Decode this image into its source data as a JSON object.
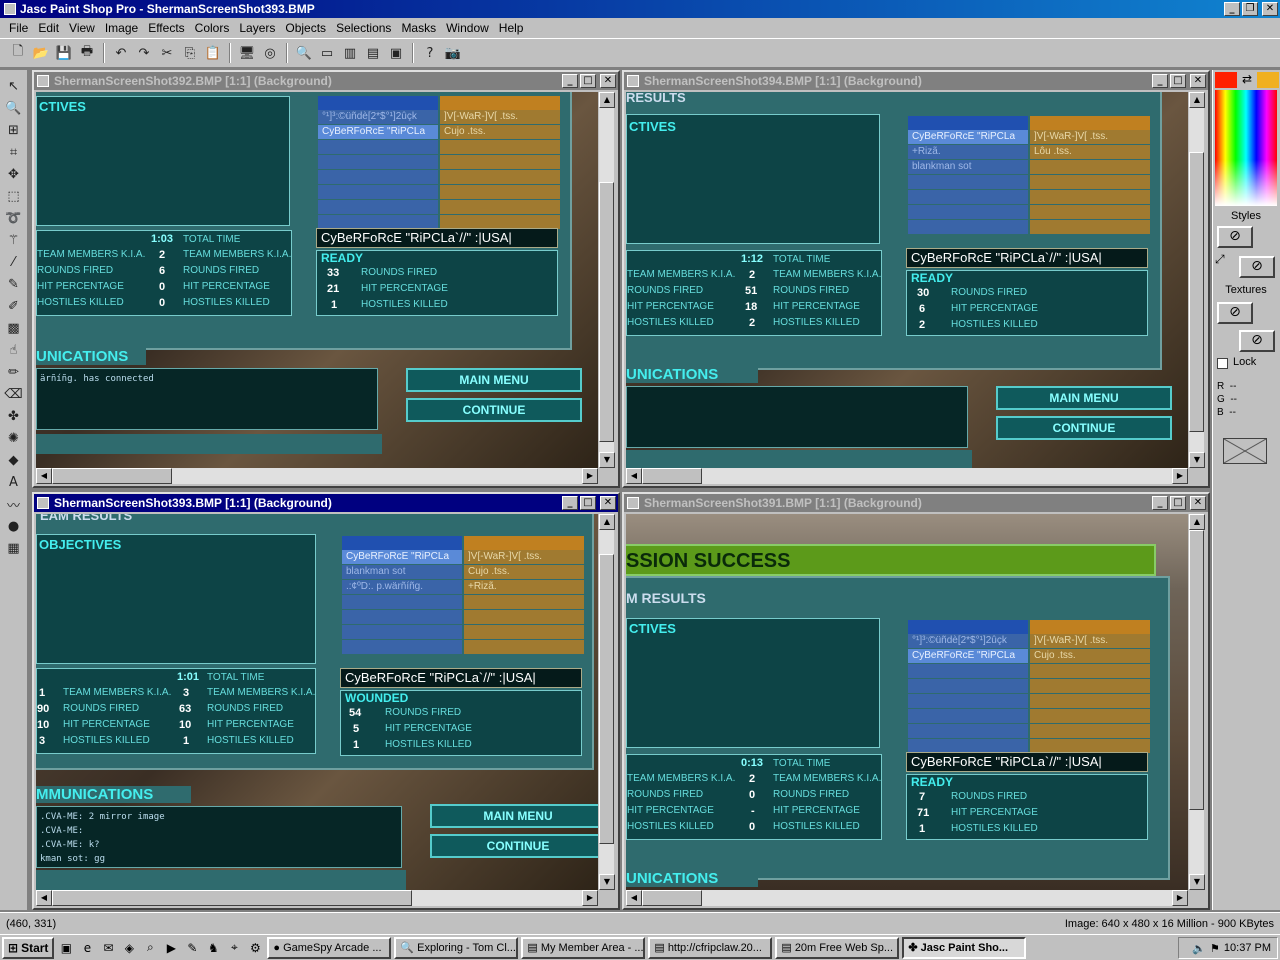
{
  "app": {
    "title": "Jasc Paint Shop Pro - ShermanScreenShot393.BMP"
  },
  "menu": [
    "File",
    "Edit",
    "View",
    "Image",
    "Effects",
    "Colors",
    "Layers",
    "Objects",
    "Selections",
    "Masks",
    "Window",
    "Help"
  ],
  "windows": {
    "w392": {
      "title": "ShermanScreenShot392.BMP [1:1] (Background)"
    },
    "w394": {
      "title": "ShermanScreenShot394.BMP [1:1] (Background)"
    },
    "w393": {
      "title": "ShermanScreenShot393.BMP [1:1] (Background)"
    },
    "w391": {
      "title": "ShermanScreenShot391.BMP [1:1] (Background)"
    }
  },
  "game": {
    "objectives_a": "CTIVES",
    "objectives_c": "OBJECTIVES",
    "results_b": "RESULTS",
    "results_c": "EAM RESULTS",
    "results_d": "M RESULTS",
    "mission_success": "SSION SUCCESS",
    "comms_a": "UNICATIONS",
    "comms_c": "MMUNICATIONS",
    "player_name": "CyBeRFoRcE \"RiPCLa`//\" :|USA|",
    "main_menu": "MAIN MENU",
    "continue": "CONTINUE",
    "total_time": "TOTAL TIME",
    "labels": {
      "team_kia": "TEAM MEMBERS K.I.A.",
      "rounds": "ROUNDS FIRED",
      "hit": "HIT PERCENTAGE",
      "hostiles": "HOSTILES KILLED"
    },
    "a": {
      "time": "1:03",
      "status": "READY",
      "team_vals": [
        "2",
        "6",
        "0",
        "0"
      ],
      "personal_vals": [
        "33",
        "21",
        "1"
      ],
      "blue_team": [
        "°¹]³:©üñdè[2*$°¹]2ûçk",
        "CyBeRFoRcE \"RiPCLa"
      ],
      "orange_team": [
        "]V[-WaR-]V[ .tss.",
        "Cujo .tss."
      ],
      "chat": [
        "ärñíñg. has connected"
      ]
    },
    "b": {
      "time": "1:12",
      "status": "READY",
      "team_vals": [
        "2",
        "51",
        "18",
        "2"
      ],
      "personal_vals": [
        "30",
        "6",
        "2"
      ],
      "blue_team": [
        "CyBeRFoRcE \"RiPCLa",
        "+Rizã.",
        "blankman sot"
      ],
      "orange_team": [
        "]V[-WaR-]V[ .tss.",
        "Lôu .tss."
      ]
    },
    "c": {
      "time": "1:01",
      "status": "WOUNDED",
      "left_vals": [
        "1",
        "90",
        "10",
        "3"
      ],
      "team_vals": [
        "3",
        "63",
        "10",
        "1"
      ],
      "personal_vals": [
        "54",
        "5",
        "1"
      ],
      "blue_team": [
        "CyBeRFoRcE \"RiPCLa",
        "blankman sot",
        ".:¢ºD:. p.wärñíñg."
      ],
      "orange_team": [
        "]V[-WaR-]V[ .tss.",
        "Cujo .tss.",
        "+Rizã."
      ],
      "chat": [
        ".CVA-ME: 2 mirror image",
        ".CVA-ME:",
        ".CVA-ME: k?",
        "kman sot: gg"
      ]
    },
    "d": {
      "time": "0:13",
      "status": "READY",
      "team_vals": [
        "2",
        "0",
        "-",
        "0"
      ],
      "personal_vals": [
        "7",
        "71",
        "1"
      ],
      "blue_team": [
        "°¹]³:©üñdè[2*$°¹]2ûçk",
        "CyBeRFoRcE \"RiPCLa"
      ],
      "orange_team": [
        "]V[-WaR-]V[ .tss.",
        "Cujo .tss."
      ]
    }
  },
  "right_panel": {
    "styles": "Styles",
    "textures": "Textures",
    "lock": "Lock",
    "r": "R",
    "g": "G",
    "b": "B",
    "r_val": "--",
    "g_val": "--",
    "b_val": "--"
  },
  "status": {
    "coords": "(460, 331)",
    "image_info": "Image:  640 x 480 x 16 Million - 900 KBytes"
  },
  "taskbar": {
    "start": "Start",
    "tasks": [
      "GameSpy Arcade ...",
      "Exploring - Tom Cl...",
      "My Member Area - ...",
      "http://cfripclaw.20...",
      "20m Free Web Sp...",
      "Jasc Paint Sho..."
    ],
    "clock": "10:37 PM"
  },
  "colors": {
    "title_active": "#000080",
    "game_teal": "#2f6b6e",
    "fg_color": "#ff2000",
    "bg_color": "#f0b020"
  }
}
